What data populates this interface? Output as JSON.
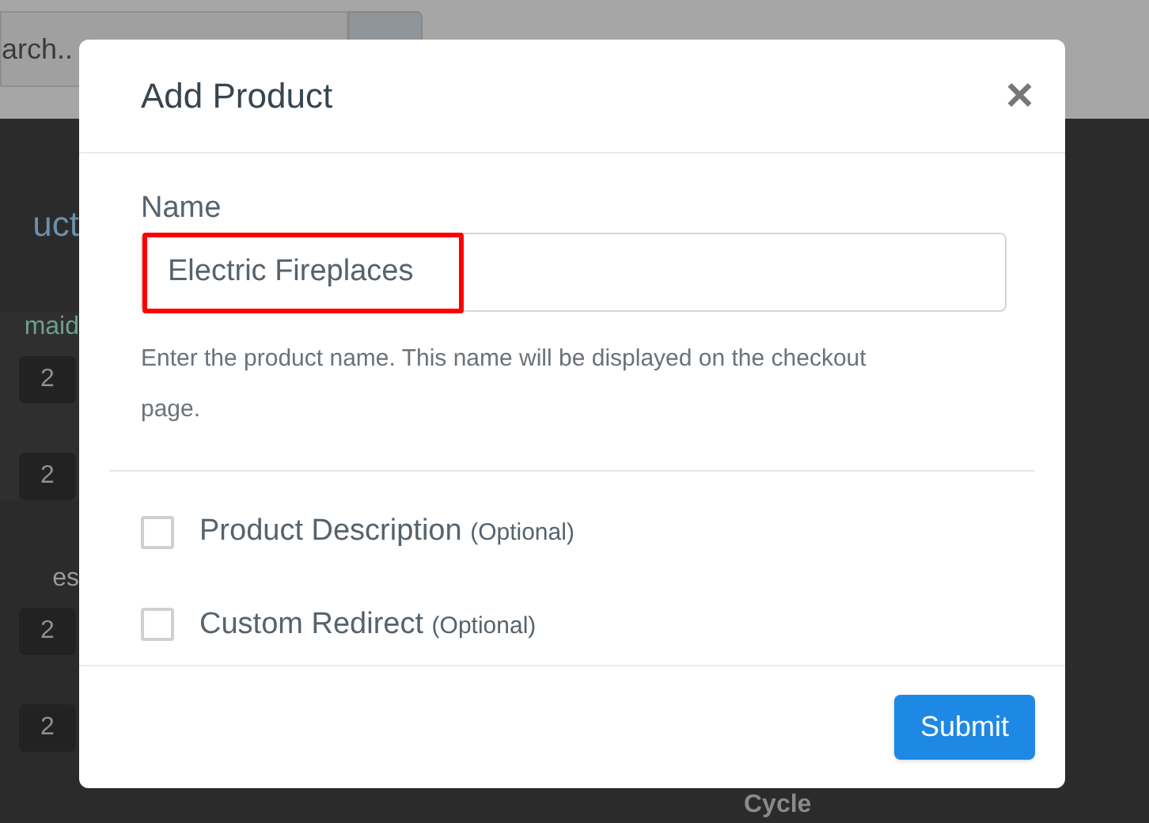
{
  "background": {
    "search": {
      "placeholder": "arch.."
    },
    "heading": "uct",
    "labels": [
      {
        "text": "maid",
        "badges": [
          "2",
          "2"
        ]
      },
      {
        "text": "es",
        "badges": [
          "2",
          "2"
        ]
      }
    ],
    "footer_text": "Cycle"
  },
  "modal": {
    "title": "Add Product",
    "close": "×",
    "name_label": "Name",
    "name_value": "Electric Fireplaces",
    "name_highlighted": true,
    "help": "Enter the product name. This name will be displayed on the checkout page.",
    "options": [
      {
        "label": "Product Description",
        "note": "(Optional)",
        "checked": false
      },
      {
        "label": "Custom Redirect",
        "note": "(Optional)",
        "checked": false
      }
    ],
    "submit": "Submit"
  }
}
